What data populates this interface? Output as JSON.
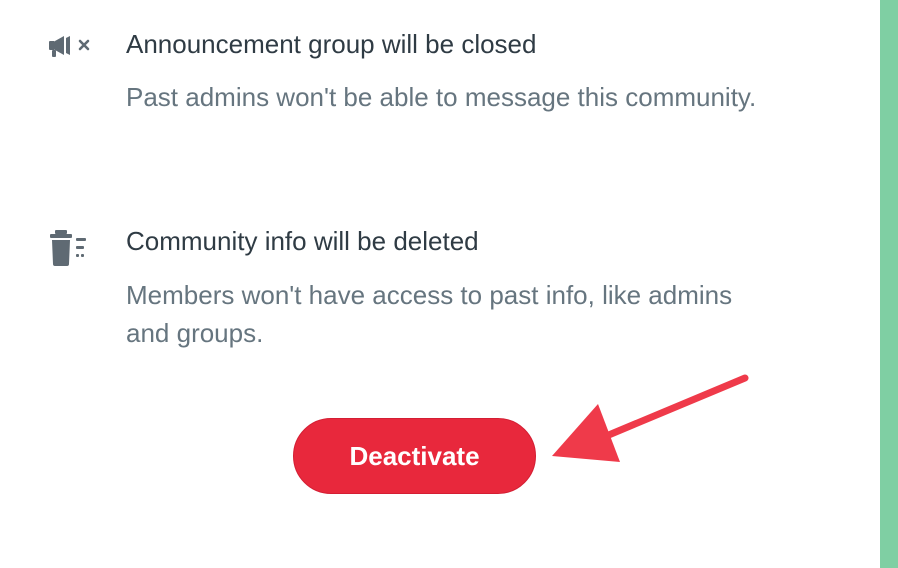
{
  "colors": {
    "accent_red": "#e8283c",
    "side_strip_green": "#7fcfa3",
    "arrow_red": "#ef3a4a",
    "icon_gray": "#5f6a73"
  },
  "items": [
    {
      "icon": "megaphone-muted-icon",
      "title": "Announcement group will be closed",
      "description": "Past admins won't be able to message this community."
    },
    {
      "icon": "trash-list-icon",
      "title": "Community info will be deleted",
      "description": "Members won't have access to past info, like admins and groups."
    }
  ],
  "actions": {
    "deactivate_label": "Deactivate"
  }
}
